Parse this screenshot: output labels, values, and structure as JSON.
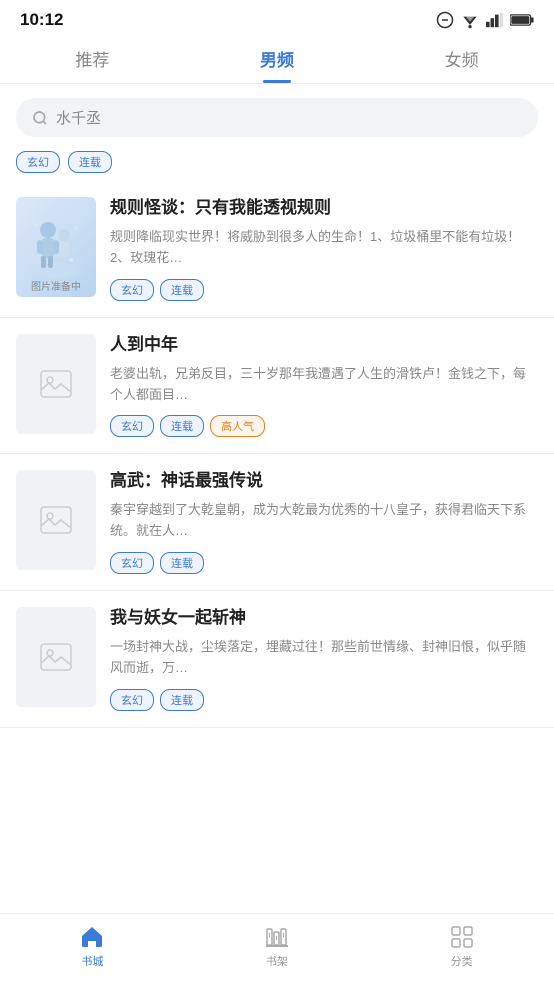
{
  "statusBar": {
    "time": "10:12"
  },
  "topNav": {
    "tabs": [
      {
        "id": "tuijian",
        "label": "推荐",
        "active": false
      },
      {
        "id": "nanpin",
        "label": "男频",
        "active": true
      },
      {
        "id": "nvpin",
        "label": "女频",
        "active": false
      }
    ]
  },
  "search": {
    "placeholder": "水千丞"
  },
  "partialTags": [
    {
      "label": "玄幻",
      "style": "blue"
    },
    {
      "label": "连载",
      "style": "blue"
    }
  ],
  "books": [
    {
      "id": "book1",
      "title": "规则怪谈：只有我能透视规则",
      "description": "规则降临现实世界！将威胁到很多人的生命！1、垃圾桶里不能有垃圾！2、玫瑰花…",
      "tags": [
        {
          "label": "玄幻",
          "style": "blue"
        },
        {
          "label": "连载",
          "style": "blue"
        }
      ],
      "coverType": "special",
      "coverLabel": "图片准备中"
    },
    {
      "id": "book2",
      "title": "人到中年",
      "description": "老婆出轨，兄弟反目，三十岁那年我遭遇了人生的滑铁卢！金钱之下，每个人都面目…",
      "tags": [
        {
          "label": "玄幻",
          "style": "blue"
        },
        {
          "label": "连载",
          "style": "blue"
        },
        {
          "label": "高人气",
          "style": "orange"
        }
      ],
      "coverType": "placeholder"
    },
    {
      "id": "book3",
      "title": "高武：神话最强传说",
      "description": "秦宇穿越到了大乾皇朝，成为大乾最为优秀的十八皇子，获得君临天下系统。就在人…",
      "tags": [
        {
          "label": "玄幻",
          "style": "blue"
        },
        {
          "label": "连载",
          "style": "blue"
        }
      ],
      "coverType": "placeholder"
    },
    {
      "id": "book4",
      "title": "我与妖女一起斩神",
      "description": "一场封神大战，尘埃落定，埋藏过往！那些前世情缘、封神旧恨，似乎随风而逝，万…",
      "tags": [
        {
          "label": "玄幻",
          "style": "blue"
        },
        {
          "label": "连载",
          "style": "blue"
        }
      ],
      "coverType": "placeholder"
    }
  ],
  "bottomNav": {
    "items": [
      {
        "id": "shucheng",
        "label": "书城",
        "active": true,
        "icon": "home"
      },
      {
        "id": "shujia",
        "label": "书架",
        "active": false,
        "icon": "bookshelf"
      },
      {
        "id": "fenlei",
        "label": "分类",
        "active": false,
        "icon": "grid"
      }
    ]
  }
}
